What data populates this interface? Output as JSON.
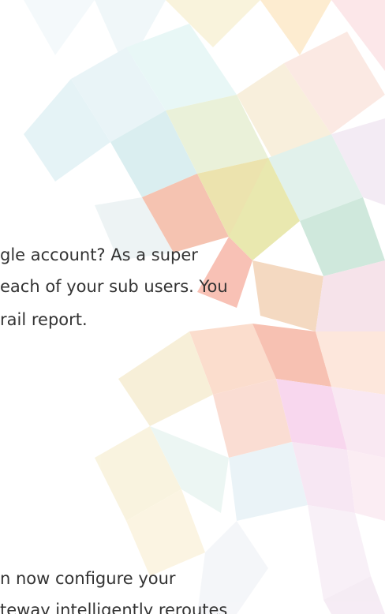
{
  "paragraph_one": {
    "lines": [
      "gle account? As a super",
      " each of your sub users. You",
      "rail report."
    ]
  },
  "paragraph_two": {
    "lines": [
      "n now configure your",
      "teway intelligently reroutes"
    ]
  },
  "colors": {
    "text": "#333333",
    "background": "#ffffff"
  }
}
